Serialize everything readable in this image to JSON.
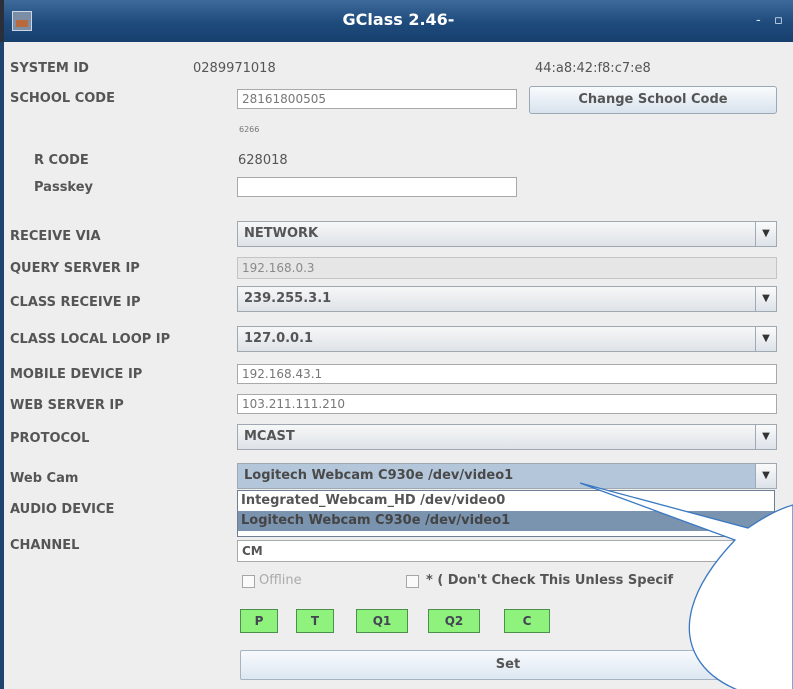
{
  "window": {
    "title": "GClass 2.46-",
    "controls": {
      "minimize": "-",
      "maximize": "▫"
    }
  },
  "system": {
    "system_id_label": "SYSTEM ID",
    "system_id_value": "0289971018",
    "mac": "44:a8:42:f8:c7:e8"
  },
  "school": {
    "label": "SCHOOL CODE",
    "value": "28161800505",
    "hint": "6266",
    "change_button": "Change School Code"
  },
  "rcode": {
    "label": "R CODE",
    "value": "628018"
  },
  "passkey": {
    "label": "Passkey",
    "value": ""
  },
  "receive_via": {
    "label": "RECEIVE VIA",
    "value": "NETWORK"
  },
  "query_server_ip": {
    "label": "QUERY SERVER IP",
    "value": "192.168.0.3"
  },
  "class_receive_ip": {
    "label": "CLASS RECEIVE IP",
    "value": "239.255.3.1"
  },
  "class_local_loop_ip": {
    "label": "CLASS LOCAL LOOP IP",
    "value": "127.0.0.1"
  },
  "mobile_device_ip": {
    "label": "MOBILE DEVICE IP",
    "value": "192.168.43.1"
  },
  "web_server_ip": {
    "label": "WEB SERVER IP",
    "value": "103.211.111.210"
  },
  "protocol": {
    "label": "PROTOCOL",
    "value": "MCAST"
  },
  "web_cam": {
    "label": "Web Cam",
    "value": "Logitech Webcam C930e /dev/video1",
    "options": [
      "Integrated_Webcam_HD /dev/video0",
      "Logitech Webcam C930e /dev/video1"
    ]
  },
  "audio_device": {
    "label": "AUDIO DEVICE"
  },
  "channel": {
    "label": "CHANNEL",
    "value": "CM"
  },
  "offline": {
    "label": "Offline"
  },
  "dont_check": {
    "label": "* ( Don't Check This Unless Specif"
  },
  "quick_buttons": [
    "P",
    "T",
    "Q1",
    "Q2",
    "C"
  ],
  "set_button": "Set",
  "colors": {
    "titlebar": "#1e4b7c",
    "green_button": "#8ef27c",
    "callout_stroke": "#3a78c2"
  }
}
